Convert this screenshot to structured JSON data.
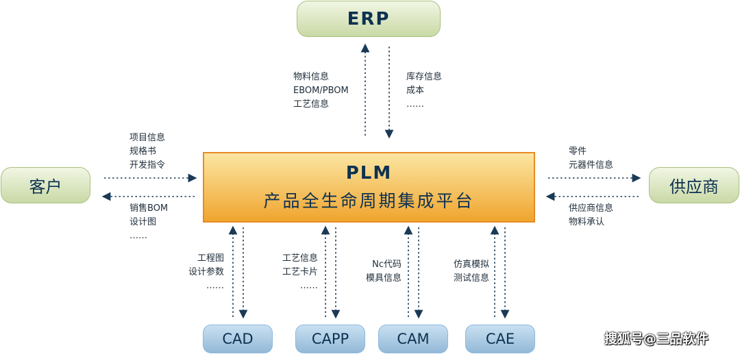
{
  "nodes": {
    "erp": "ERP",
    "plm_title": "PLM",
    "plm_subtitle": "产品全生命周期集成平台",
    "customer": "客户",
    "supplier": "供应商",
    "cad": "CAD",
    "capp": "CAPP",
    "cam": "CAM",
    "cae": "CAE"
  },
  "labels": {
    "erp_up": [
      "物料信息",
      "EBOM/PBOM",
      "工艺信息"
    ],
    "erp_down": [
      "库存信息",
      "成本",
      "……"
    ],
    "customer_to_plm": [
      "项目信息",
      "规格书",
      "开发指令"
    ],
    "plm_to_customer": [
      "销售BOM",
      "设计图",
      "……"
    ],
    "plm_to_supplier": [
      "零件",
      "元器件信息"
    ],
    "supplier_to_plm": [
      "供应商信息",
      "物料承认"
    ],
    "cad": [
      "工程图",
      "设计参数",
      "……"
    ],
    "capp": [
      "工艺信息",
      "工艺卡片",
      "……"
    ],
    "cam": [
      "Nc代码",
      "模具信息"
    ],
    "cae": [
      "仿真模拟",
      "测试信息"
    ]
  },
  "watermark": "搜狐号@三品软件",
  "colors": {
    "text": "#0d3150",
    "arrow": "#1a3a56",
    "plm_border": "#e78b23",
    "green_node": "#c9d9a5",
    "blue_node": "#93b9d7"
  }
}
